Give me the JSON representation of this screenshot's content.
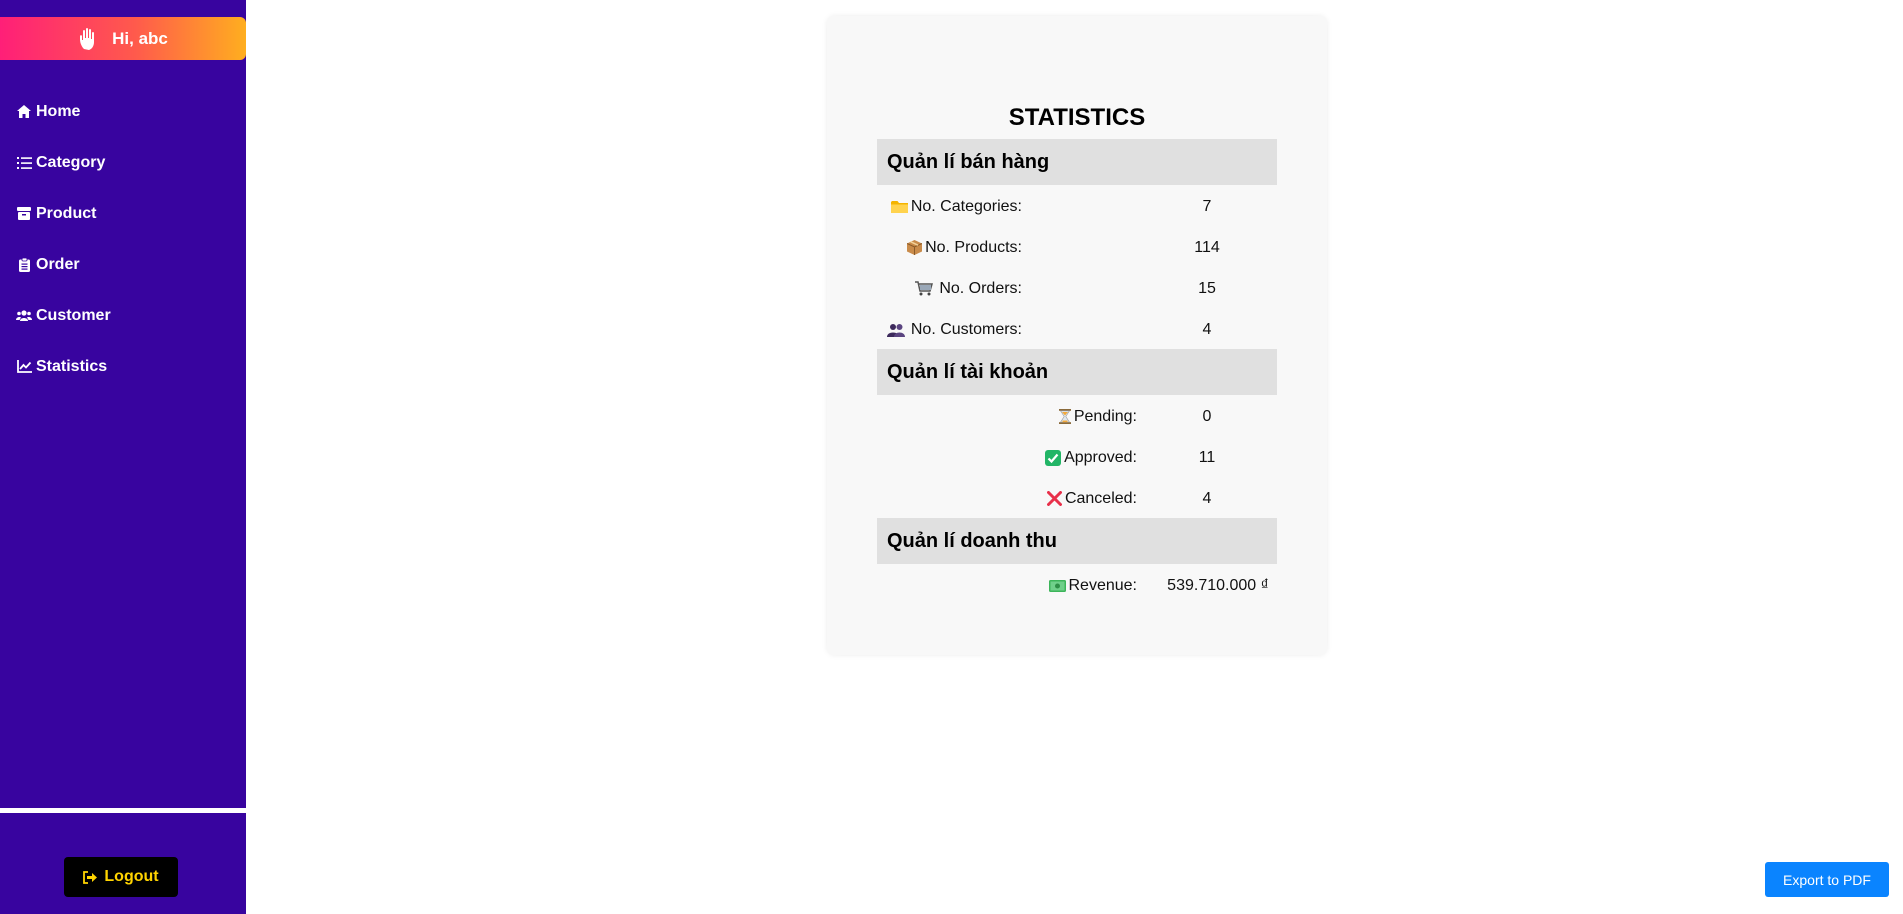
{
  "sidebar": {
    "greeting": "Hi, abc",
    "items": [
      {
        "label": "Home",
        "icon": "home-icon"
      },
      {
        "label": "Category",
        "icon": "list-icon"
      },
      {
        "label": "Product",
        "icon": "box-icon"
      },
      {
        "label": "Order",
        "icon": "clipboard-icon"
      },
      {
        "label": "Customer",
        "icon": "users-icon"
      },
      {
        "label": "Statistics",
        "icon": "chart-line-icon"
      }
    ],
    "logout_label": "Logout",
    "colors": {
      "background": "#38049f",
      "greeting_gradient": [
        "#ff1f78",
        "#ffae1f"
      ],
      "logout_text": "#ffd400"
    }
  },
  "stats": {
    "title": "STATISTICS",
    "sections": [
      {
        "heading": "Quản lí bán hàng",
        "rows": [
          {
            "icon": "folder-icon",
            "label": "No. Categories:",
            "value": "7"
          },
          {
            "icon": "package-icon",
            "label": "No. Products:",
            "value": "114"
          },
          {
            "icon": "cart-icon",
            "label": "No. Orders:",
            "value": "15"
          },
          {
            "icon": "people-icon",
            "label": "No. Customers:",
            "value": "4"
          }
        ]
      },
      {
        "heading": "Quản lí tài khoản",
        "rows": [
          {
            "icon": "hourglass-icon",
            "label": "Pending:",
            "value": "0"
          },
          {
            "icon": "check-icon",
            "label": "Approved:",
            "value": "11"
          },
          {
            "icon": "cross-icon",
            "label": "Canceled:",
            "value": "4"
          }
        ]
      },
      {
        "heading": "Quản lí doanh thu",
        "rows": [
          {
            "icon": "money-icon",
            "label": "Revenue:",
            "value": "539.710.000 ₫"
          }
        ]
      }
    ]
  },
  "export_label": "Export to PDF"
}
